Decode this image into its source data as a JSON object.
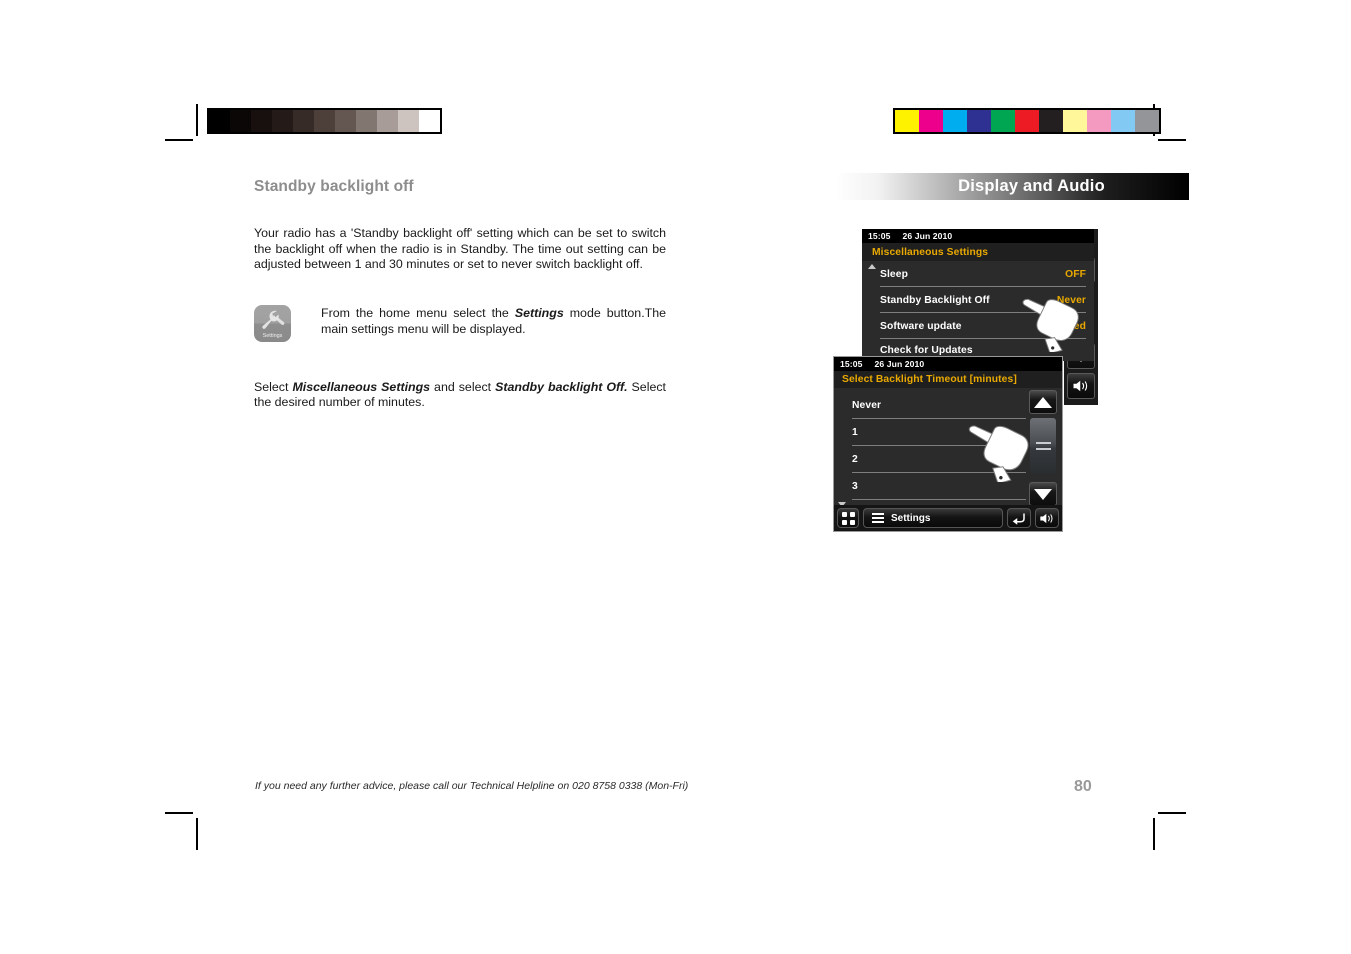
{
  "page": {
    "number": "80",
    "footer_note": "If you need any further advice, please call our Technical Helpline on 020 8758 0338 (Mon-Fri)"
  },
  "left_column": {
    "heading": "Standby backlight off",
    "paragraph_1": "Your radio has a 'Standby backlight off' setting which can be set to switch the backlight off when the radio is in Standby. The time out setting can be adjusted between 1 and 30 minutes or set to never switch backlight off.",
    "icon_step": {
      "tile_label": "Settings",
      "tile_icon": "wrench-icon",
      "text_before": "From the home menu select the ",
      "text_bold": "Settings",
      "text_after": " mode button.The main settings menu will be displayed."
    },
    "paragraph_2": {
      "part_1": "Select ",
      "bold_1": "Miscellaneous Settings",
      "part_2": " and select ",
      "bold_2": "Standby backlight Off.",
      "part_3": " Select the desired number of minutes."
    }
  },
  "right_column": {
    "section_title": "Display and Audio",
    "screen_top": {
      "status_time": "15:05",
      "status_date": "26 Jun 2010",
      "menu_title": "Miscellaneous Settings",
      "rows": [
        {
          "label": "Sleep",
          "value": "OFF"
        },
        {
          "label": "Standby Backlight Off",
          "value": "Never"
        },
        {
          "label": "Software update",
          "value": "Enabled"
        },
        {
          "label": "Check for Updates",
          "value": ""
        }
      ],
      "controls": {
        "up": "triangle-up-icon",
        "scroll": "scroll-thumb-icon",
        "down": "triangle-down-icon",
        "volume": "volume-icon"
      }
    },
    "screen_bottom": {
      "status_time": "15:05",
      "status_date": "26 Jun 2010",
      "menu_title": "Select Backlight Timeout [minutes]",
      "rows": [
        {
          "label": "Never"
        },
        {
          "label": "1"
        },
        {
          "label": "2"
        },
        {
          "label": "3"
        }
      ],
      "toolbar": {
        "home_icon": "grid-home-icon",
        "menu_icon": "hamburger-icon",
        "menu_label": "Settings",
        "back_icon": "back-arrow-icon",
        "volume_icon": "volume-icon"
      },
      "controls": {
        "up": "triangle-up-icon",
        "scroll": "scroll-thumb-icon",
        "down": "triangle-down-icon"
      }
    }
  },
  "calibration": {
    "grayscale": [
      "#000000",
      "#0a0706",
      "#18100e",
      "#241a17",
      "#372b27",
      "#4d403b",
      "#645650",
      "#827670",
      "#a79c97",
      "#cdc4bf",
      "#ffffff"
    ],
    "colors": [
      "#fff200",
      "#ec008c",
      "#00aeef",
      "#2e3192",
      "#00a651",
      "#ed1c24",
      "#231f20",
      "#fff79a",
      "#f49ac1",
      "#82caf3",
      "#939598"
    ]
  }
}
